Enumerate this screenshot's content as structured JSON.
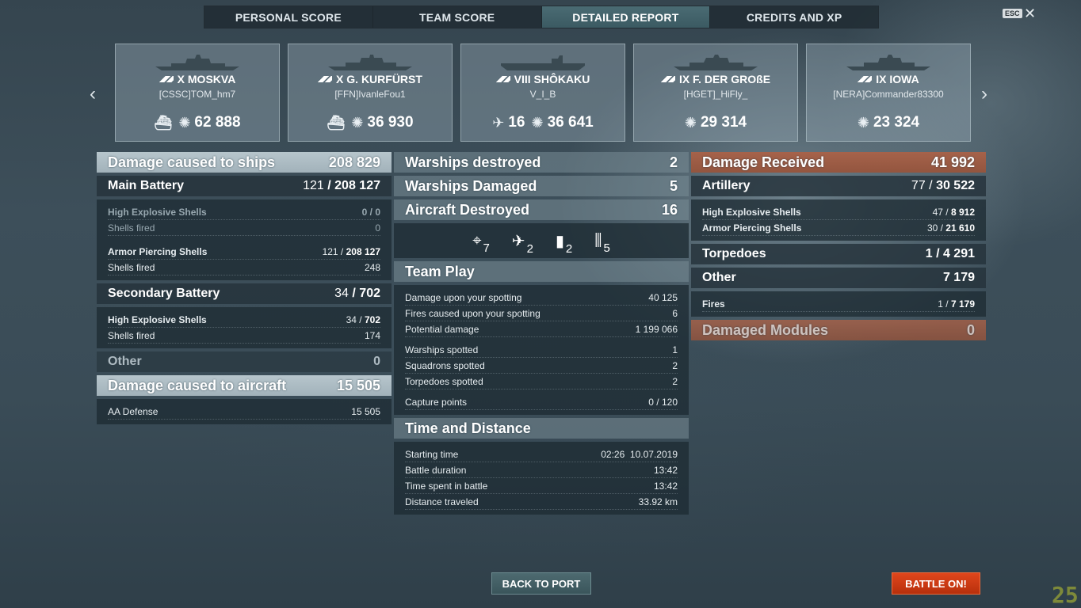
{
  "tabs": [
    {
      "label": "PERSONAL SCORE"
    },
    {
      "label": "TEAM SCORE"
    },
    {
      "label": "DETAILED REPORT"
    },
    {
      "label": "CREDITS AND XP"
    }
  ],
  "esc_label": "ESC",
  "close_glyph": "✕",
  "nav": {
    "prev": "‹",
    "next": "›"
  },
  "ships": [
    {
      "name": "X MOSKVA",
      "player": "[CSSC]TOM_hm7",
      "stats": [
        {
          "icon": "ship-hit-icon",
          "value": ""
        },
        {
          "icon": "damage-icon",
          "value": "62 888"
        }
      ]
    },
    {
      "name": "X G. KURFÜRST",
      "player": "[FFN]IvanleFou1",
      "stats": [
        {
          "icon": "ship-hit-icon",
          "value": ""
        },
        {
          "icon": "damage-icon",
          "value": "36 930"
        }
      ]
    },
    {
      "name": "VIII SHÔKAKU",
      "player": "V_I_B",
      "stats": [
        {
          "icon": "plane-shot-icon",
          "value": "16"
        },
        {
          "icon": "damage-icon",
          "value": "36 641"
        }
      ]
    },
    {
      "name": "IX F. DER GROßE",
      "player": "[HGET]_HiFly_",
      "stats": [
        {
          "icon": "damage-icon",
          "value": "29 314"
        }
      ]
    },
    {
      "name": "IX IOWA",
      "player": "[NERA]Commander83300",
      "stats": [
        {
          "icon": "damage-icon",
          "value": "23 324"
        }
      ]
    }
  ],
  "left": {
    "header": {
      "label": "Damage caused to ships",
      "value": "208 829"
    },
    "main_battery": {
      "label": "Main Battery",
      "hits": "121",
      "value": "208 127"
    },
    "he": {
      "label": "High Explosive Shells",
      "value": "0 / 0"
    },
    "he_fired": {
      "label": "Shells fired",
      "value": "0"
    },
    "ap": {
      "label": "Armor Piercing Shells",
      "hits": "121 /",
      "value": "208 127"
    },
    "ap_fired": {
      "label": "Shells fired",
      "value": "248"
    },
    "secondary": {
      "label": "Secondary Battery",
      "hits": "34",
      "value": "702"
    },
    "sec_he": {
      "label": "High Explosive Shells",
      "hits": "34 /",
      "value": "702"
    },
    "sec_fired": {
      "label": "Shells fired",
      "value": "174"
    },
    "other": {
      "label": "Other",
      "value": "0"
    },
    "aircraft": {
      "label": "Damage caused to aircraft",
      "value": "15 505"
    },
    "aa": {
      "label": "AA Defense",
      "value": "15 505"
    }
  },
  "middle": {
    "destroyed": {
      "label": "Warships destroyed",
      "value": "2"
    },
    "damaged": {
      "label": "Warships Damaged",
      "value": "5"
    },
    "aircraft": {
      "label": "Aircraft Destroyed",
      "value": "16"
    },
    "ribbons": [
      {
        "icon": "crosshair-icon",
        "glyph": "⌖",
        "count": "7"
      },
      {
        "icon": "plane-destroyed-icon",
        "glyph": "✈",
        "count": "2"
      },
      {
        "icon": "shell-icon",
        "glyph": "▮",
        "count": "2"
      },
      {
        "icon": "secondary-hit-icon",
        "glyph": "⫼",
        "count": "5"
      }
    ],
    "team_play": {
      "title": "Team Play",
      "rows": [
        {
          "label": "Damage upon your spotting",
          "value": "40 125"
        },
        {
          "label": "Fires caused upon your spotting",
          "value": "6"
        },
        {
          "label": "Potential damage",
          "value": "1 199 066"
        },
        {
          "label": "Warships spotted",
          "value": "1"
        },
        {
          "label": "Squadrons spotted",
          "value": "2"
        },
        {
          "label": "Torpedoes spotted",
          "value": "2"
        },
        {
          "label": "Capture points",
          "value": "0 / 120"
        }
      ]
    },
    "time": {
      "title": "Time and Distance",
      "rows": [
        {
          "label": "Starting time",
          "value": "02:26  10.07.2019"
        },
        {
          "label": "Battle duration",
          "value": "13:42"
        },
        {
          "label": "Time spent in battle",
          "value": "13:42"
        },
        {
          "label": "Distance traveled",
          "value": "33.92 km"
        }
      ]
    }
  },
  "right": {
    "header": {
      "label": "Damage Received",
      "value": "41 992"
    },
    "artillery": {
      "label": "Artillery",
      "hits": "77 /",
      "value": "30 522"
    },
    "he": {
      "label": "High Explosive Shells",
      "hits": "47 /",
      "value": "8 912"
    },
    "ap": {
      "label": "Armor Piercing Shells",
      "hits": "30 /",
      "value": "21 610"
    },
    "torpedoes": {
      "label": "Torpedoes",
      "value": "1 / 4 291"
    },
    "other": {
      "label": "Other",
      "value": "7 179"
    },
    "fires": {
      "label": "Fires",
      "hits": "1 /",
      "value": "7 179"
    },
    "modules": {
      "label": "Damaged Modules",
      "value": "0"
    }
  },
  "buttons": {
    "back": "BACK TO PORT",
    "battle": "BATTLE ON!"
  },
  "fps": "25",
  "colors": {
    "accent_orange": "#d23c14",
    "header_light": "#bccad1",
    "damage_received": "#a86246"
  }
}
